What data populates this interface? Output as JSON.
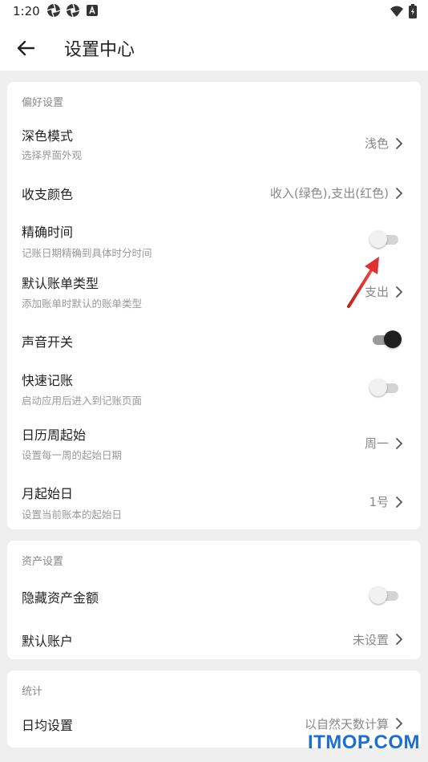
{
  "status_bar": {
    "time": "1:20"
  },
  "app_bar": {
    "title": "设置中心"
  },
  "preferences": {
    "section_title": "偏好设置",
    "dark_mode": {
      "title": "深色模式",
      "subtitle": "选择界面外观",
      "value": "浅色"
    },
    "income_color": {
      "title": "收支颜色",
      "value": "收入(绿色),支出(红色)"
    },
    "precise_time": {
      "title": "精确时间",
      "subtitle": "记账日期精确到具体时分时间",
      "enabled": false
    },
    "default_bill_type": {
      "title": "默认账单类型",
      "subtitle": "添加账单时默认的账单类型",
      "value": "支出"
    },
    "sound": {
      "title": "声音开关",
      "enabled": true
    },
    "quick_record": {
      "title": "快速记账",
      "subtitle": "启动应用后进入到记账页面",
      "enabled": false
    },
    "week_start": {
      "title": "日历周起始",
      "subtitle": "设置每一周的起始日期",
      "value": "周一"
    },
    "month_start": {
      "title": "月起始日",
      "subtitle": "设置当前账本的起始日",
      "value": "1号"
    }
  },
  "assets": {
    "section_title": "资产设置",
    "hide_amount": {
      "title": "隐藏资产金额",
      "enabled": false
    },
    "default_account": {
      "title": "默认账户",
      "value": "未设置"
    }
  },
  "stats": {
    "section_title": "统计",
    "daily_avg": {
      "title": "日均设置",
      "value": "以自然天数计算"
    }
  },
  "watermark": "ITMOP.COM",
  "colors": {
    "annotation_arrow": "#d92b2b",
    "watermark": "#1a6fd1"
  }
}
